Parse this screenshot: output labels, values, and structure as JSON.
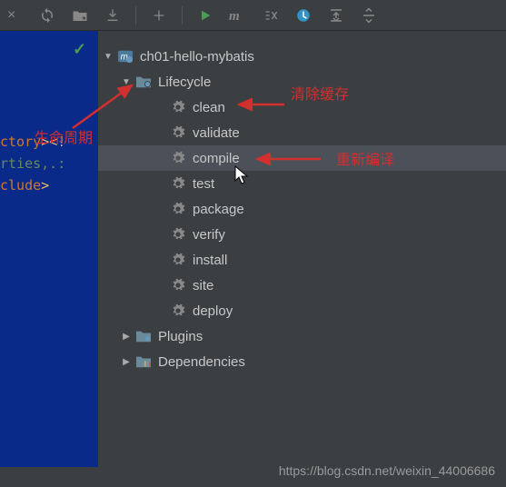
{
  "toolbar": {
    "close": "×"
  },
  "editor": {
    "line1_a": "ctory",
    "line1_b": ">",
    "line1_c": "<!",
    "line2": "rties,.:",
    "line3_a": "clude",
    "line3_b": ">"
  },
  "tree": {
    "root": "ch01-hello-mybatis",
    "lifecycle": {
      "label": "Lifecycle",
      "goals": [
        "clean",
        "validate",
        "compile",
        "test",
        "package",
        "verify",
        "install",
        "site",
        "deploy"
      ]
    },
    "plugins": "Plugins",
    "dependencies": "Dependencies"
  },
  "annotations": {
    "lifecycle_note": "生命周期",
    "clean_note": "清除缓存",
    "compile_note": "重新编译"
  },
  "watermark": "https://blog.csdn.net/weixin_44006686"
}
